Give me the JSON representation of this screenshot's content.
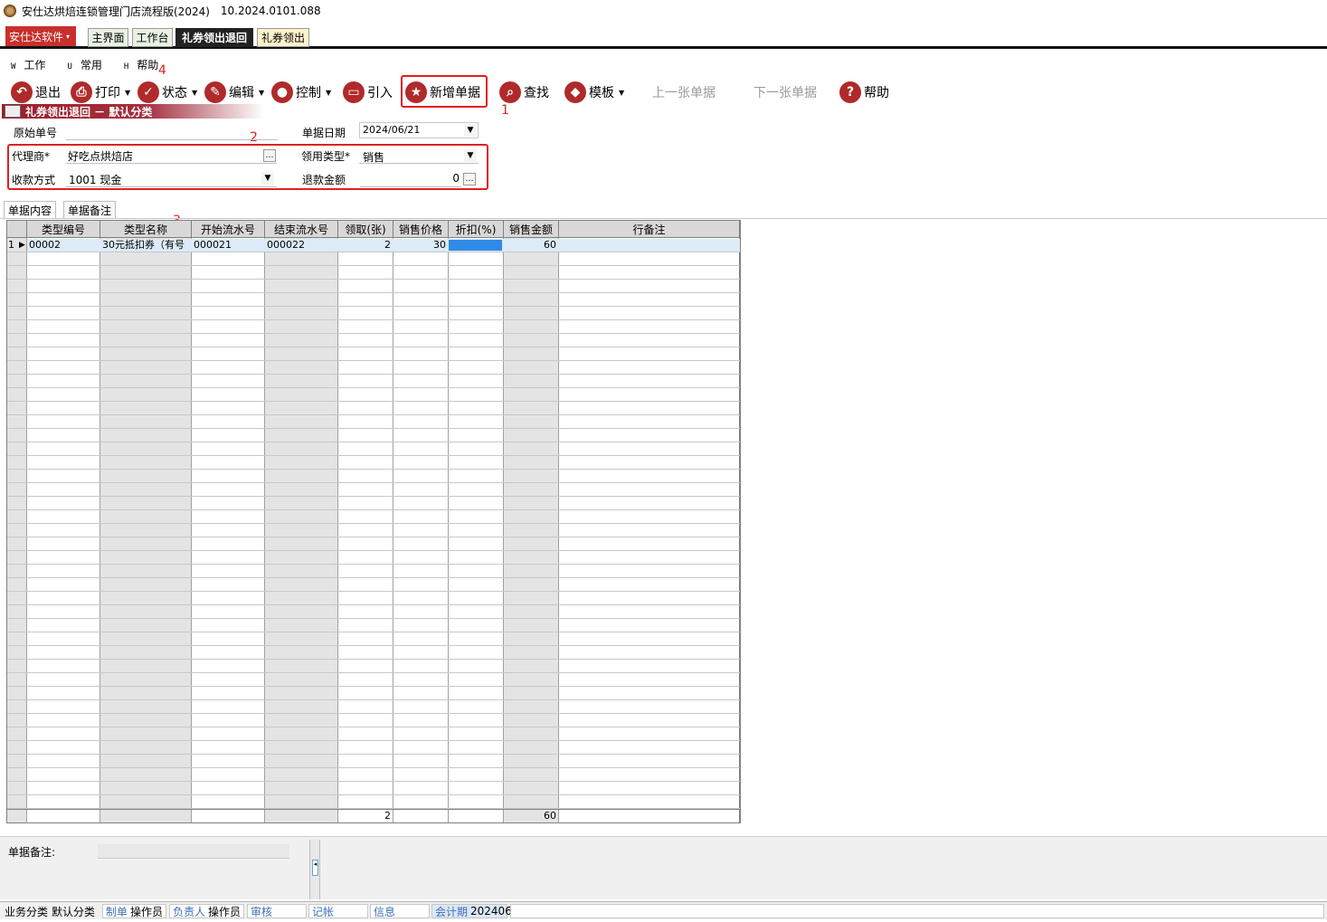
{
  "window": {
    "title": "安仕达烘焙连锁管理门店流程版(2024)",
    "version": "10.2024.0101.088"
  },
  "brand_menu": {
    "label": "安仕达软件",
    "arrow": "▾"
  },
  "tabs": [
    {
      "label": "主界面"
    },
    {
      "label": "工作台"
    },
    {
      "label": "礼券领出退回"
    },
    {
      "label": "礼券领出"
    }
  ],
  "menu": [
    {
      "key": "W",
      "label": "工作"
    },
    {
      "key": "U",
      "label": "常用"
    },
    {
      "key": "H",
      "label": "帮助"
    }
  ],
  "toolbar": {
    "exit": "退出",
    "print": "打印",
    "status": "状态",
    "edit": "编辑",
    "control": "控制",
    "import": "引入",
    "new": "新增单据",
    "find": "查找",
    "template": "模板",
    "prev": "上一张单据",
    "next": "下一张单据",
    "help": "帮助"
  },
  "annotations": {
    "a1": "1",
    "a2": "2",
    "a3": "3",
    "a4": "4"
  },
  "doc_title": "礼券领出退回 － 默认分类",
  "form": {
    "orig_no_label": "原始单号",
    "orig_no_value": "",
    "date_label": "单据日期",
    "date_value": "2024/06/21",
    "agent_label": "代理商*",
    "agent_value": "好吃点烘焙店",
    "use_type_label": "领用类型*",
    "use_type_value": "销售",
    "pay_label": "收款方式",
    "pay_value": "1001 现金",
    "refund_label": "退款金额",
    "refund_value": "0"
  },
  "subtabs": [
    "单据内容",
    "单据备注"
  ],
  "grid": {
    "columns": [
      "类型编号",
      "类型名称",
      "开始流水号",
      "结束流水号",
      "领取(张)",
      "销售价格",
      "折扣(%)",
      "销售金额",
      "行备注"
    ],
    "rows": [
      {
        "no": "1",
        "type_code": "00002",
        "type_name": "30元抵扣券（有号",
        "start": "000021",
        "end": "000022",
        "qty": "2",
        "price": "30",
        "discount": "",
        "amount": "60",
        "remark": ""
      }
    ],
    "totals": {
      "qty": "2",
      "amount": "60"
    }
  },
  "remarks_label": "单据备注:",
  "statusbar": {
    "category_label": "业务分类",
    "category_value": "默认分类",
    "maker_label": "制单",
    "maker_value": "操作员",
    "owner_label": "负责人",
    "owner_value": "操作员",
    "audit_label": "审核",
    "post_label": "记帐",
    "info_label": "信息",
    "period_label": "会计期",
    "period_value": "202406"
  },
  "colors": {
    "accent_red": "#b02a2a",
    "annotation_red": "#e02020",
    "selection_blue": "#2e8be6",
    "row_highlight": "#dcebf7"
  }
}
